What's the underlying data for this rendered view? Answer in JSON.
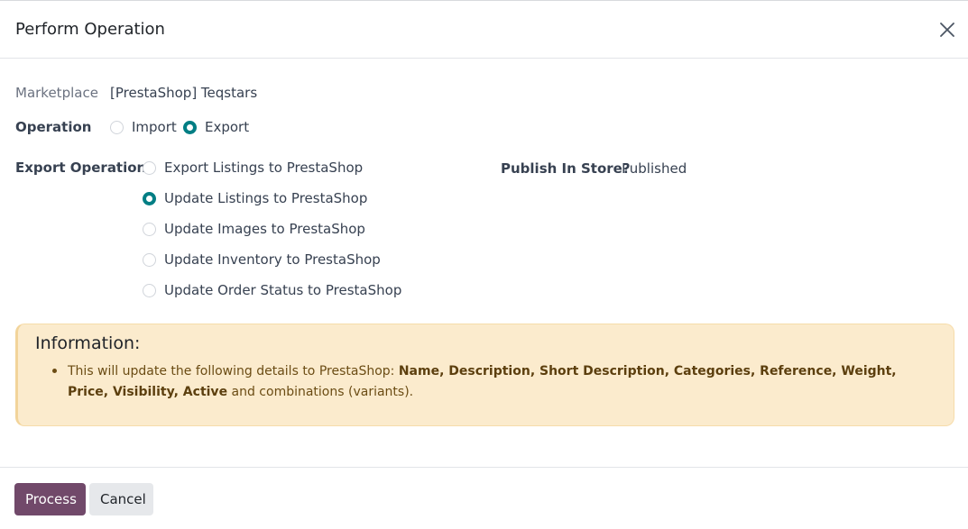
{
  "dialog": {
    "title": "Perform Operation"
  },
  "form": {
    "marketplace_label": "Marketplace",
    "marketplace_value": "[PrestaShop] Teqstars",
    "operation_label": "Operation",
    "operation_options": [
      {
        "label": "Import",
        "checked": false
      },
      {
        "label": "Export",
        "checked": true
      }
    ],
    "export_operation_label": "Export Operation",
    "export_operation_options": [
      {
        "label": "Export Listings to PrestaShop",
        "checked": false
      },
      {
        "label": "Update Listings to PrestaShop",
        "checked": true
      },
      {
        "label": "Update Images to PrestaShop",
        "checked": false
      },
      {
        "label": "Update Inventory to PrestaShop",
        "checked": false
      },
      {
        "label": "Update Order Status to PrestaShop",
        "checked": false
      }
    ],
    "publish_label": "Publish In Store?",
    "publish_value": "Published"
  },
  "info": {
    "heading": "Information:",
    "text_prefix": "This will update the following details to PrestaShop: ",
    "text_bold": "Name, Description, Short Description, Categories, Reference, Weight, Price, Visibility, Active",
    "text_suffix": " and combinations (variants)."
  },
  "footer": {
    "process_label": "Process",
    "cancel_label": "Cancel"
  },
  "colors": {
    "accent": "#017e84",
    "primary_button": "#71496a",
    "alert_bg": "#fbebcd"
  }
}
